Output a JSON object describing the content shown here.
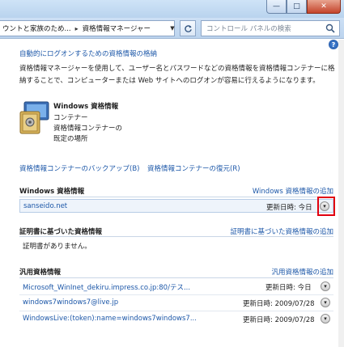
{
  "window": {
    "min_glyph": "—",
    "max_glyph": "□",
    "close_glyph": "✕"
  },
  "address": {
    "crumb1": "ウントと家族のため...",
    "crumb2": "資格情報マネージャー",
    "search_placeholder": "コントロール パネルの検索"
  },
  "help_glyph": "?",
  "header_link": "自動的にログオンするための資格情報の格納",
  "description": "資格情報マネージャーを使用して、ユーザー名とパスワードなどの資格情報を資格情報コンテナーに格納することで、コンピューターまたは Web サイトへのログオンが容易に行えるようになります。",
  "vault": {
    "title": "Windows 資格情報",
    "line2": "コンテナー",
    "line3": "資格情報コンテナーの",
    "line4": "既定の場所"
  },
  "actions": {
    "backup": "資格情報コンテナーのバックアップ(B)",
    "restore": "資格情報コンテナーの復元(R)"
  },
  "windows_section": {
    "title": "Windows 資格情報",
    "add": "Windows 資格情報の追加",
    "rows": [
      {
        "name": "sanseido.net",
        "modified": "更新日時:  今日"
      }
    ]
  },
  "cert_section": {
    "title": "証明書に基づいた資格情報",
    "add": "証明書に基づいた資格情報の追加",
    "empty": "証明書がありません。"
  },
  "generic_section": {
    "title": "汎用資格情報",
    "add": "汎用資格情報の追加",
    "rows": [
      {
        "name": "Microsoft_WinInet_dekiru.impress.co.jp:80/テス...",
        "modified": "更新日時:  今日"
      },
      {
        "name": "windows7windows7@live.jp",
        "modified": "更新日時:  2009/07/28"
      },
      {
        "name": "WindowsLive:(token):name=windows7windows7...",
        "modified": "更新日時:  2009/07/28"
      }
    ]
  }
}
